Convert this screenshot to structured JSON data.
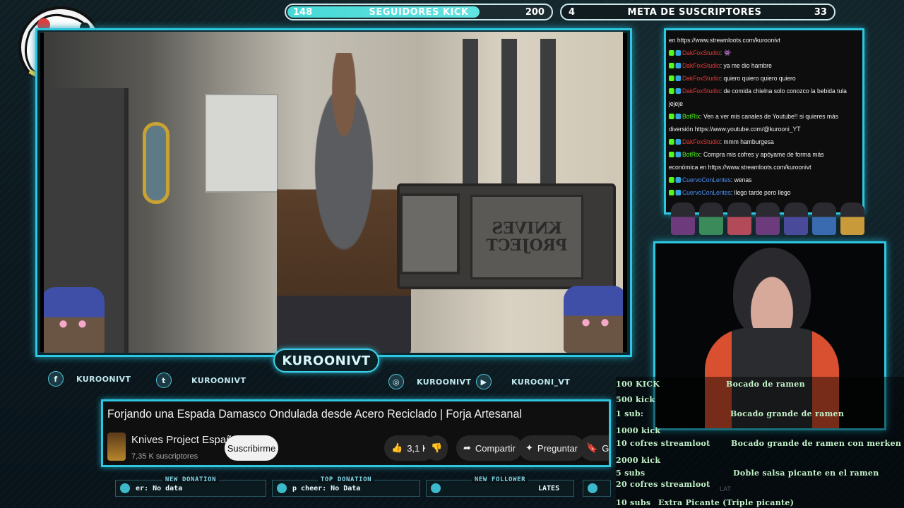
{
  "top_goals": {
    "kick": {
      "current": "148",
      "label": "SEGUIDORES KICK",
      "target": "200",
      "progress": 0.74
    },
    "subs": {
      "current": "4",
      "label": "META DE SUSCRIPTORES",
      "target": "33"
    }
  },
  "streamer_name": "KUROONIVT",
  "video": {
    "forge_plate_text": "KNIVES PROJECT"
  },
  "socials": [
    {
      "icon": "facebook-icon",
      "glyph": "f",
      "handle": "KUROONIVT"
    },
    {
      "icon": "twitter-icon",
      "glyph": "t",
      "handle": "KUROONIVT"
    },
    {
      "icon": "instagram-icon",
      "glyph": "◎",
      "handle": "KUROONIVT"
    },
    {
      "icon": "youtube-icon",
      "glyph": "▶",
      "handle": "KUROONI_VT"
    }
  ],
  "youtube_card": {
    "title": "Forjando una Espada Damasco Ondulada desde Acero Reciclado | Forja Artesanal",
    "channel": "Knives Project Español",
    "subscribers": "7,35 K suscriptores",
    "subscribe_label": "Suscribirme",
    "likes": "3,1 K",
    "share_label": "Compartir",
    "ask_label": "Preguntar",
    "save_label": "Gu"
  },
  "ticker": {
    "new_donation": {
      "label": "NEW DONATION",
      "value": "er: No data"
    },
    "top_donation": {
      "label": "TOP DONATION",
      "value": "p cheer: No Data"
    },
    "new_follower": {
      "label": "NEW FOLLOWER",
      "value": ""
    },
    "latest": {
      "label": "",
      "value": "LATES"
    }
  },
  "chat": [
    {
      "user": "",
      "text": "en https://www.streamloots.com/kuroonivt"
    },
    {
      "user": "DakFoxStudio",
      "color": "red",
      "text": ": 👾"
    },
    {
      "user": "DakFoxStudio",
      "color": "red",
      "text": ": ya me dio hambre"
    },
    {
      "user": "DakFoxStudio",
      "color": "red",
      "text": ": quiero quiero quiero quiero"
    },
    {
      "user": "DakFoxStudio",
      "color": "red",
      "text": ": de comida chielna solo conozco la bebida tula jejeje"
    },
    {
      "user": "BotRix",
      "color": "green",
      "text": ": Ven a ver mis canales de Youtube!! si quieres más diversión https://www.youtube.com/@kurooni_YT"
    },
    {
      "user": "DakFoxStudio",
      "color": "red",
      "text": ": mmm hamburgesa"
    },
    {
      "user": "BotRix",
      "color": "green",
      "text": ": Compra mis cofres y apóyame de forma más económica en https://www.streamloots.com/kuroonivt"
    },
    {
      "user": "CuervoConLentes",
      "color": "blue",
      "text": ": wenas"
    },
    {
      "user": "CuervoConLentes",
      "color": "blue",
      "text": ": llego tarde pero llego"
    }
  ],
  "goals_list": [
    {
      "req": "100 KICK",
      "reward": "Bocado de ramen"
    },
    {
      "req": "500 kick",
      "reward": ""
    },
    {
      "req": "1 sub:",
      "reward": "Bocado grande de ramen"
    },
    {
      "req": "1000 kick",
      "reward": ""
    },
    {
      "req": "10 cofres streamloot",
      "reward": "Bocado grande de ramen con merken"
    },
    {
      "req": "2000 kick",
      "reward": ""
    },
    {
      "req": "5 subs",
      "reward": "Doble salsa picante en el ramen"
    },
    {
      "req": "20 cofres streamloot",
      "reward": ""
    },
    {
      "req": "10 subs",
      "reward": "Extra Picante (Triple picante)"
    }
  ],
  "lat_text": "LAT",
  "colors": {
    "accent": "#2ec6e0",
    "kick_green": "#53fc18",
    "bar_fill": "#46d9d6"
  }
}
